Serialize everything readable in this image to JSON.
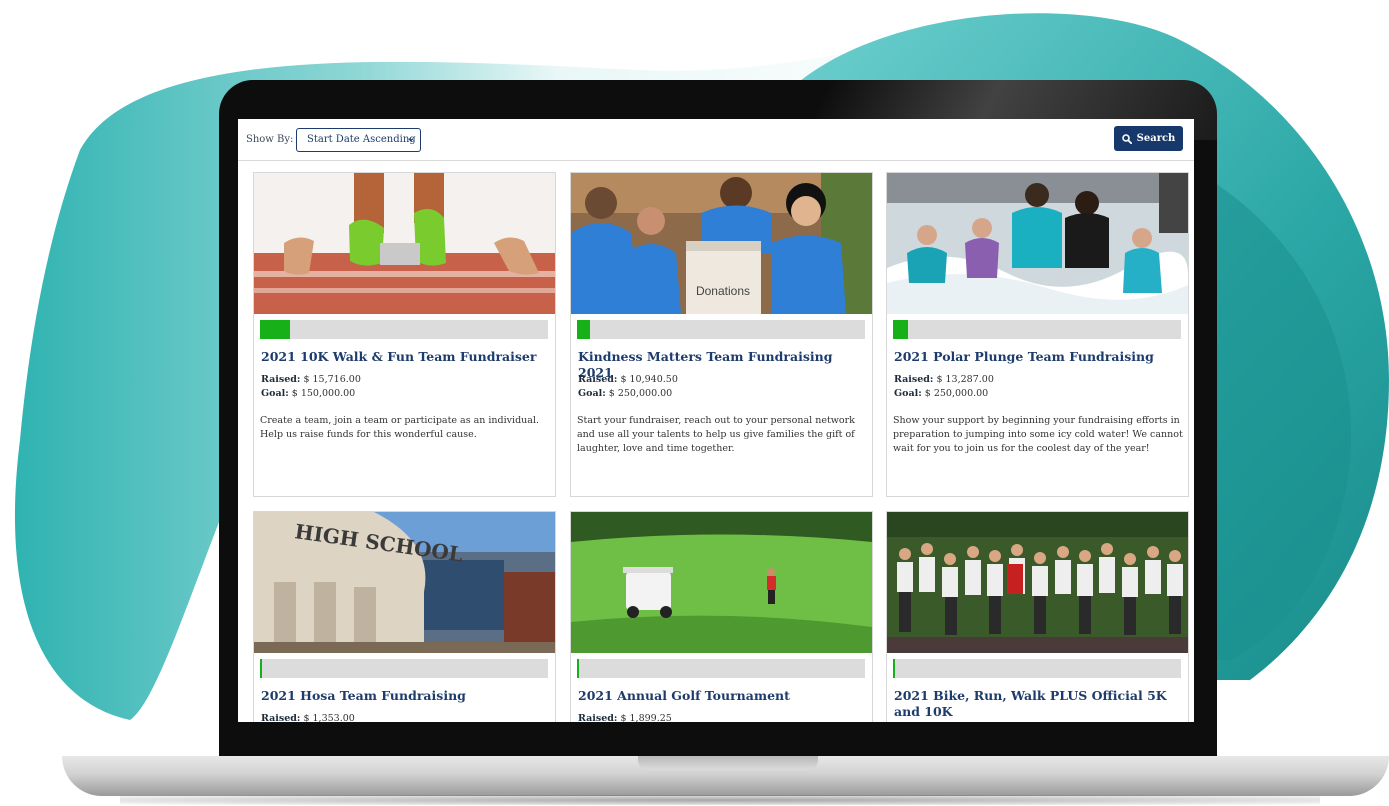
{
  "toolbar": {
    "show_by_label": "Show By:",
    "sort_value": "Start Date Ascending",
    "search_label": "Search"
  },
  "cards": [
    {
      "title": "2021 10K Walk & Fun Team Fundraiser",
      "raised_label": "Raised:",
      "raised": "$ 15,716.00",
      "goal_label": "Goal:",
      "goal": "$ 150,000.00",
      "progress": 0.105,
      "description": "Create a team, join a team or participate as an individual. Help us raise funds for this wonderful cause."
    },
    {
      "title": "Kindness Matters Team Fundraising 2021",
      "raised_label": "Raised:",
      "raised": "$ 10,940.50",
      "goal_label": "Goal:",
      "goal": "$ 250,000.00",
      "progress": 0.044,
      "description": "Start your fundraiser, reach out to your personal network and use all your talents to help us give families the gift of laughter, love and time together."
    },
    {
      "title": "2021 Polar Plunge Team Fundraising",
      "raised_label": "Raised:",
      "raised": "$ 13,287.00",
      "goal_label": "Goal:",
      "goal": "$ 250,000.00",
      "progress": 0.053,
      "description": "Show your support by beginning your fundraising efforts in preparation to jumping into some icy cold water! We cannot wait for you to join us for the coolest day of the year!"
    },
    {
      "title": "2021 Hosa Team Fundraising",
      "raised_label": "Raised:",
      "raised": "$ 1,353.00",
      "progress": 0.005
    },
    {
      "title": "2021 Annual Golf Tournament",
      "raised_label": "Raised:",
      "raised": "$ 1,899.25",
      "progress": 0.006
    },
    {
      "title": "2021 Bike, Run, Walk PLUS Official 5K and 10K",
      "progress": 0.004
    }
  ],
  "photo_text": {
    "donations_box": "Donations",
    "school_sign": "HIGH SCHOOL"
  },
  "colors": {
    "brand_navy": "#17386a",
    "progress_green": "#18b018",
    "teal": "#39b9b8"
  }
}
